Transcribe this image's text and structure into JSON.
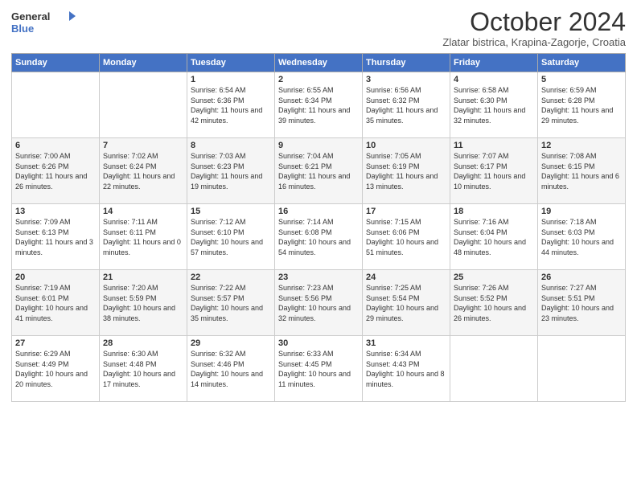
{
  "header": {
    "logo_general": "General",
    "logo_blue": "Blue",
    "title": "October 2024",
    "subtitle": "Zlatar bistrica, Krapina-Zagorje, Croatia"
  },
  "weekdays": [
    "Sunday",
    "Monday",
    "Tuesday",
    "Wednesday",
    "Thursday",
    "Friday",
    "Saturday"
  ],
  "weeks": [
    [
      {
        "day": "",
        "info": ""
      },
      {
        "day": "",
        "info": ""
      },
      {
        "day": "1",
        "info": "Sunrise: 6:54 AM\nSunset: 6:36 PM\nDaylight: 11 hours and 42 minutes."
      },
      {
        "day": "2",
        "info": "Sunrise: 6:55 AM\nSunset: 6:34 PM\nDaylight: 11 hours and 39 minutes."
      },
      {
        "day": "3",
        "info": "Sunrise: 6:56 AM\nSunset: 6:32 PM\nDaylight: 11 hours and 35 minutes."
      },
      {
        "day": "4",
        "info": "Sunrise: 6:58 AM\nSunset: 6:30 PM\nDaylight: 11 hours and 32 minutes."
      },
      {
        "day": "5",
        "info": "Sunrise: 6:59 AM\nSunset: 6:28 PM\nDaylight: 11 hours and 29 minutes."
      }
    ],
    [
      {
        "day": "6",
        "info": "Sunrise: 7:00 AM\nSunset: 6:26 PM\nDaylight: 11 hours and 26 minutes."
      },
      {
        "day": "7",
        "info": "Sunrise: 7:02 AM\nSunset: 6:24 PM\nDaylight: 11 hours and 22 minutes."
      },
      {
        "day": "8",
        "info": "Sunrise: 7:03 AM\nSunset: 6:23 PM\nDaylight: 11 hours and 19 minutes."
      },
      {
        "day": "9",
        "info": "Sunrise: 7:04 AM\nSunset: 6:21 PM\nDaylight: 11 hours and 16 minutes."
      },
      {
        "day": "10",
        "info": "Sunrise: 7:05 AM\nSunset: 6:19 PM\nDaylight: 11 hours and 13 minutes."
      },
      {
        "day": "11",
        "info": "Sunrise: 7:07 AM\nSunset: 6:17 PM\nDaylight: 11 hours and 10 minutes."
      },
      {
        "day": "12",
        "info": "Sunrise: 7:08 AM\nSunset: 6:15 PM\nDaylight: 11 hours and 6 minutes."
      }
    ],
    [
      {
        "day": "13",
        "info": "Sunrise: 7:09 AM\nSunset: 6:13 PM\nDaylight: 11 hours and 3 minutes."
      },
      {
        "day": "14",
        "info": "Sunrise: 7:11 AM\nSunset: 6:11 PM\nDaylight: 11 hours and 0 minutes."
      },
      {
        "day": "15",
        "info": "Sunrise: 7:12 AM\nSunset: 6:10 PM\nDaylight: 10 hours and 57 minutes."
      },
      {
        "day": "16",
        "info": "Sunrise: 7:14 AM\nSunset: 6:08 PM\nDaylight: 10 hours and 54 minutes."
      },
      {
        "day": "17",
        "info": "Sunrise: 7:15 AM\nSunset: 6:06 PM\nDaylight: 10 hours and 51 minutes."
      },
      {
        "day": "18",
        "info": "Sunrise: 7:16 AM\nSunset: 6:04 PM\nDaylight: 10 hours and 48 minutes."
      },
      {
        "day": "19",
        "info": "Sunrise: 7:18 AM\nSunset: 6:03 PM\nDaylight: 10 hours and 44 minutes."
      }
    ],
    [
      {
        "day": "20",
        "info": "Sunrise: 7:19 AM\nSunset: 6:01 PM\nDaylight: 10 hours and 41 minutes."
      },
      {
        "day": "21",
        "info": "Sunrise: 7:20 AM\nSunset: 5:59 PM\nDaylight: 10 hours and 38 minutes."
      },
      {
        "day": "22",
        "info": "Sunrise: 7:22 AM\nSunset: 5:57 PM\nDaylight: 10 hours and 35 minutes."
      },
      {
        "day": "23",
        "info": "Sunrise: 7:23 AM\nSunset: 5:56 PM\nDaylight: 10 hours and 32 minutes."
      },
      {
        "day": "24",
        "info": "Sunrise: 7:25 AM\nSunset: 5:54 PM\nDaylight: 10 hours and 29 minutes."
      },
      {
        "day": "25",
        "info": "Sunrise: 7:26 AM\nSunset: 5:52 PM\nDaylight: 10 hours and 26 minutes."
      },
      {
        "day": "26",
        "info": "Sunrise: 7:27 AM\nSunset: 5:51 PM\nDaylight: 10 hours and 23 minutes."
      }
    ],
    [
      {
        "day": "27",
        "info": "Sunrise: 6:29 AM\nSunset: 4:49 PM\nDaylight: 10 hours and 20 minutes."
      },
      {
        "day": "28",
        "info": "Sunrise: 6:30 AM\nSunset: 4:48 PM\nDaylight: 10 hours and 17 minutes."
      },
      {
        "day": "29",
        "info": "Sunrise: 6:32 AM\nSunset: 4:46 PM\nDaylight: 10 hours and 14 minutes."
      },
      {
        "day": "30",
        "info": "Sunrise: 6:33 AM\nSunset: 4:45 PM\nDaylight: 10 hours and 11 minutes."
      },
      {
        "day": "31",
        "info": "Sunrise: 6:34 AM\nSunset: 4:43 PM\nDaylight: 10 hours and 8 minutes."
      },
      {
        "day": "",
        "info": ""
      },
      {
        "day": "",
        "info": ""
      }
    ]
  ]
}
